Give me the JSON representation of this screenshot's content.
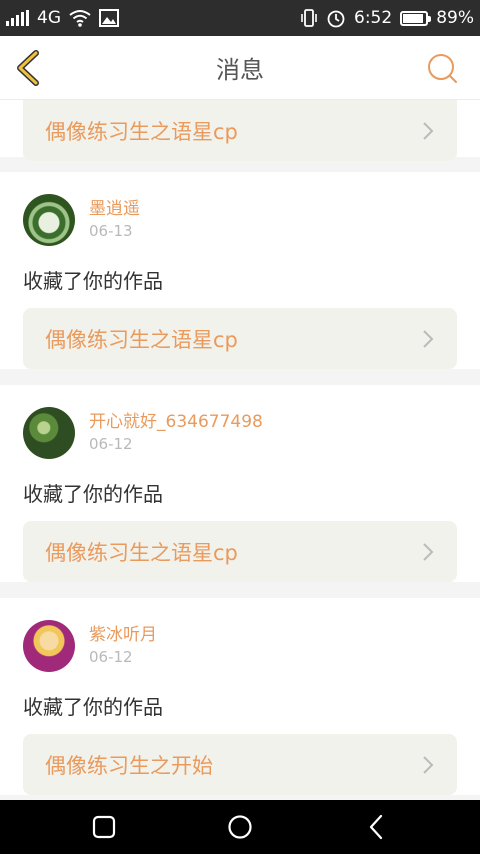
{
  "status_bar": {
    "network": "4G",
    "time": "6:52",
    "battery_text": "89%",
    "battery_level": 0.89
  },
  "header": {
    "title": "消息",
    "back_icon": "chevron-left-icon",
    "search_icon": "search-icon"
  },
  "colors": {
    "accent": "#e99a5d",
    "back_chevron": "#f0c040"
  },
  "messages": [
    {
      "work_title": "偶像练习生之语星cp"
    },
    {
      "username": "墨逍遥",
      "date": "06-13",
      "action": "收藏了你的作品",
      "work_title": "偶像练习生之语星cp"
    },
    {
      "username": "开心就好_634677498",
      "date": "06-12",
      "action": "收藏了你的作品",
      "work_title": "偶像练习生之语星cp"
    },
    {
      "username": "紫冰听月",
      "date": "06-12",
      "action": "收藏了你的作品",
      "work_title": "偶像练习生之开始"
    }
  ]
}
